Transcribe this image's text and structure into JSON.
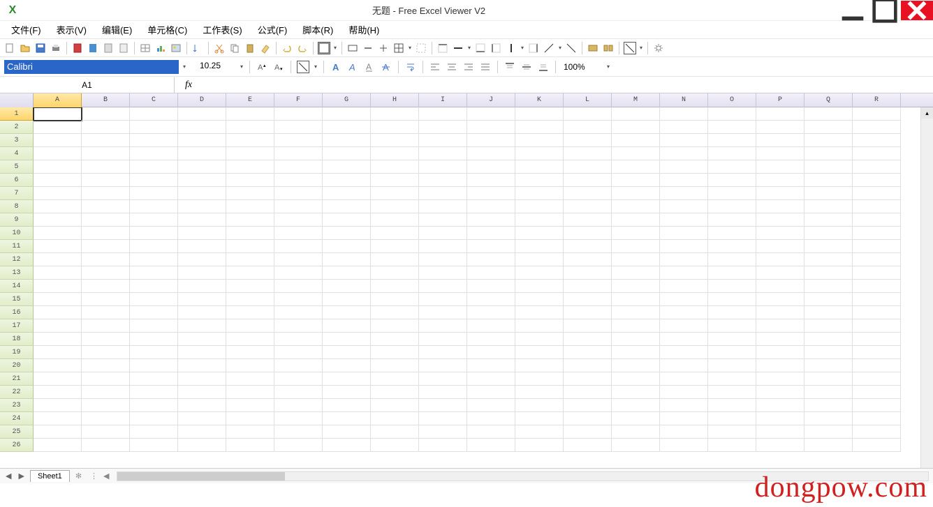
{
  "title": "无题 - Free Excel Viewer V2",
  "app_icon_letter": "X",
  "menus": [
    "文件(F)",
    "表示(V)",
    "编辑(E)",
    "单元格(C)",
    "工作表(S)",
    "公式(F)",
    "脚本(R)",
    "帮助(H)"
  ],
  "font": {
    "name": "Calibri",
    "size": "10.25"
  },
  "zoom": "100%",
  "namebox": "A1",
  "fx_label": "fx",
  "columns": [
    "A",
    "B",
    "C",
    "D",
    "E",
    "F",
    "G",
    "H",
    "I",
    "J",
    "K",
    "L",
    "M",
    "N",
    "O",
    "P",
    "Q",
    "R"
  ],
  "rows": [
    "1",
    "2",
    "3",
    "4",
    "5",
    "6",
    "7",
    "8",
    "9",
    "10",
    "11",
    "12",
    "13",
    "14",
    "15",
    "16",
    "17",
    "18",
    "19",
    "20",
    "21",
    "22",
    "23",
    "24",
    "25",
    "26"
  ],
  "selected": {
    "col": "A",
    "row": "1"
  },
  "sheet_tab": "Sheet1",
  "sheet_add": "✻",
  "scroll_nav": {
    "first": "⏮",
    "prev": "◀",
    "next": "▶"
  },
  "scroll_up": "▴",
  "watermark": "dongpow.com"
}
